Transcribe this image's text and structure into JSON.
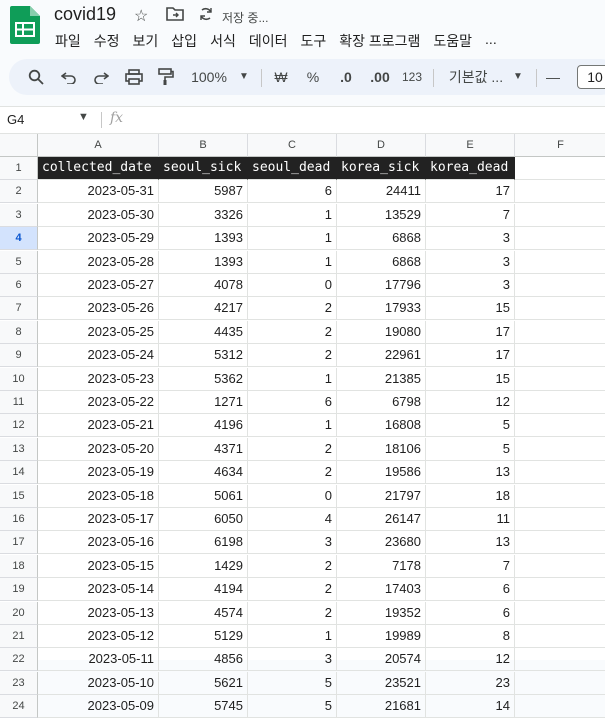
{
  "app": {
    "doc_title": "covid19",
    "save_status": "저장 중...",
    "colors": {
      "logo": "#0f9d58",
      "header_fill": "#222222",
      "selection": "#d3e3fd"
    }
  },
  "menu": [
    "파일",
    "수정",
    "보기",
    "삽입",
    "서식",
    "데이터",
    "도구",
    "확장 프로그램",
    "도움말",
    "..."
  ],
  "toolbar": {
    "zoom": "100%",
    "currency": "₩",
    "percent": "%",
    "dec_decrease": ".0",
    "dec_increase": ".00",
    "number_format": "123",
    "font": "기본값 ...",
    "font_size": "10",
    "minus": "—"
  },
  "formula_bar": {
    "name_box": "G4",
    "fx": "fx",
    "content": ""
  },
  "columns": [
    "A",
    "B",
    "C",
    "D",
    "E",
    "F"
  ],
  "selected_row": 4,
  "header_row": [
    "collected_date",
    "seoul_sick",
    "seoul_dead",
    "korea_sick",
    "korea_dead"
  ],
  "rows": [
    [
      "2023-05-31",
      "5987",
      "6",
      "24411",
      "17"
    ],
    [
      "2023-05-30",
      "3326",
      "1",
      "13529",
      "7"
    ],
    [
      "2023-05-29",
      "1393",
      "1",
      "6868",
      "3"
    ],
    [
      "2023-05-28",
      "1393",
      "1",
      "6868",
      "3"
    ],
    [
      "2023-05-27",
      "4078",
      "0",
      "17796",
      "3"
    ],
    [
      "2023-05-26",
      "4217",
      "2",
      "17933",
      "15"
    ],
    [
      "2023-05-25",
      "4435",
      "2",
      "19080",
      "17"
    ],
    [
      "2023-05-24",
      "5312",
      "2",
      "22961",
      "17"
    ],
    [
      "2023-05-23",
      "5362",
      "1",
      "21385",
      "15"
    ],
    [
      "2023-05-22",
      "1271",
      "6",
      "6798",
      "12"
    ],
    [
      "2023-05-21",
      "4196",
      "1",
      "16808",
      "5"
    ],
    [
      "2023-05-20",
      "4371",
      "2",
      "18106",
      "5"
    ],
    [
      "2023-05-19",
      "4634",
      "2",
      "19586",
      "13"
    ],
    [
      "2023-05-18",
      "5061",
      "0",
      "21797",
      "18"
    ],
    [
      "2023-05-17",
      "6050",
      "4",
      "26147",
      "11"
    ],
    [
      "2023-05-16",
      "6198",
      "3",
      "23680",
      "13"
    ],
    [
      "2023-05-15",
      "1429",
      "2",
      "7178",
      "7"
    ],
    [
      "2023-05-14",
      "4194",
      "2",
      "17403",
      "6"
    ],
    [
      "2023-05-13",
      "4574",
      "2",
      "19352",
      "6"
    ],
    [
      "2023-05-12",
      "5129",
      "1",
      "19989",
      "8"
    ],
    [
      "2023-05-11",
      "4856",
      "3",
      "20574",
      "12"
    ],
    [
      "2023-05-10",
      "5621",
      "5",
      "23521",
      "23"
    ],
    [
      "2023-05-09",
      "5745",
      "5",
      "21681",
      "14"
    ]
  ]
}
